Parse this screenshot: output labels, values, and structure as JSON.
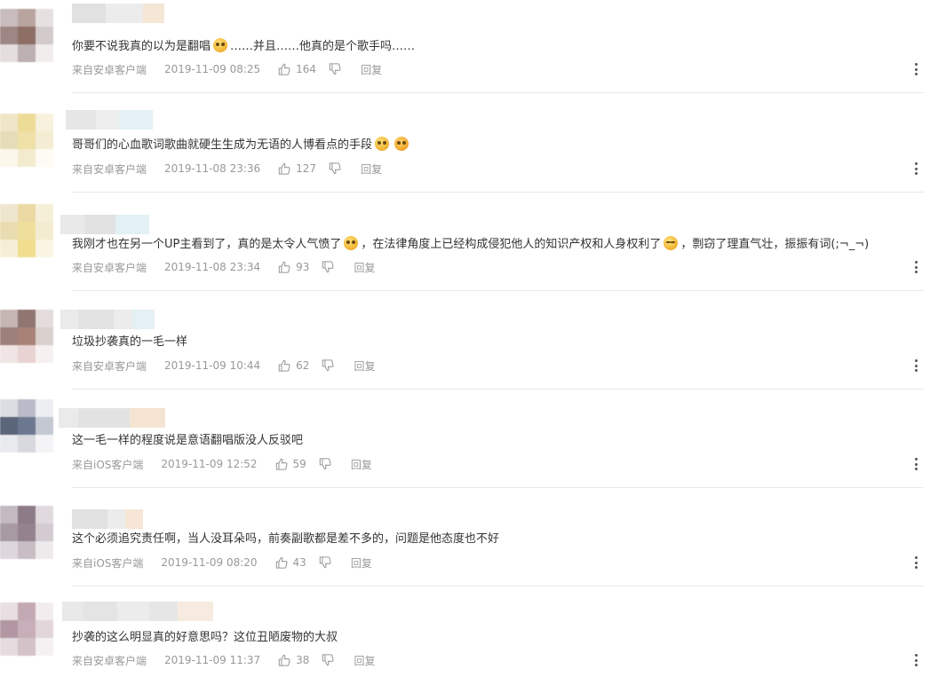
{
  "icons": {
    "like": "thumbs-up-icon",
    "dislike": "thumbs-down-icon",
    "more": "more-vertical-icon"
  },
  "labels": {
    "reply": "回复"
  },
  "comments": [
    {
      "segments": [
        "你要不说我真的以为是翻唱",
        "……并且……他真的是个歌手吗……"
      ],
      "source": "来自安卓客户端",
      "time": "2019-11-09 08:25",
      "likes": "164"
    },
    {
      "segments": [
        "哥哥们的心血歌词歌曲就硬生生成为无语的人博看点的手段",
        ""
      ],
      "source": "来自安卓客户端",
      "time": "2019-11-08 23:36",
      "likes": "127"
    },
    {
      "segments": [
        "我刚才也在另一个UP主看到了，真的是太令人气愤了",
        "，在法律角度上已经构成侵犯他人的知识产权和人身权利了",
        "，剽窃了理直气壮，振振有词(;¬_¬)"
      ],
      "source": "来自安卓客户端",
      "time": "2019-11-08 23:34",
      "likes": "93"
    },
    {
      "segments": [
        "垃圾抄袭真的一毛一样"
      ],
      "source": "来自安卓客户端",
      "time": "2019-11-09 10:44",
      "likes": "62"
    },
    {
      "segments": [
        "这一毛一样的程度说是意语翻唱版没人反驳吧"
      ],
      "source": "来自iOS客户端",
      "time": "2019-11-09 12:52",
      "likes": "59"
    },
    {
      "segments": [
        "这个必须追究责任啊，当人没耳朵吗，前奏副歌都是差不多的，问题是他态度也不好"
      ],
      "source": "来自iOS客户端",
      "time": "2019-11-09 08:20",
      "likes": "43"
    },
    {
      "segments": [
        "抄袭的这么明显真的好意思吗？这位丑陋废物的大叔"
      ],
      "source": "来自安卓客户端",
      "time": "2019-11-09 11:37",
      "likes": "38"
    }
  ]
}
